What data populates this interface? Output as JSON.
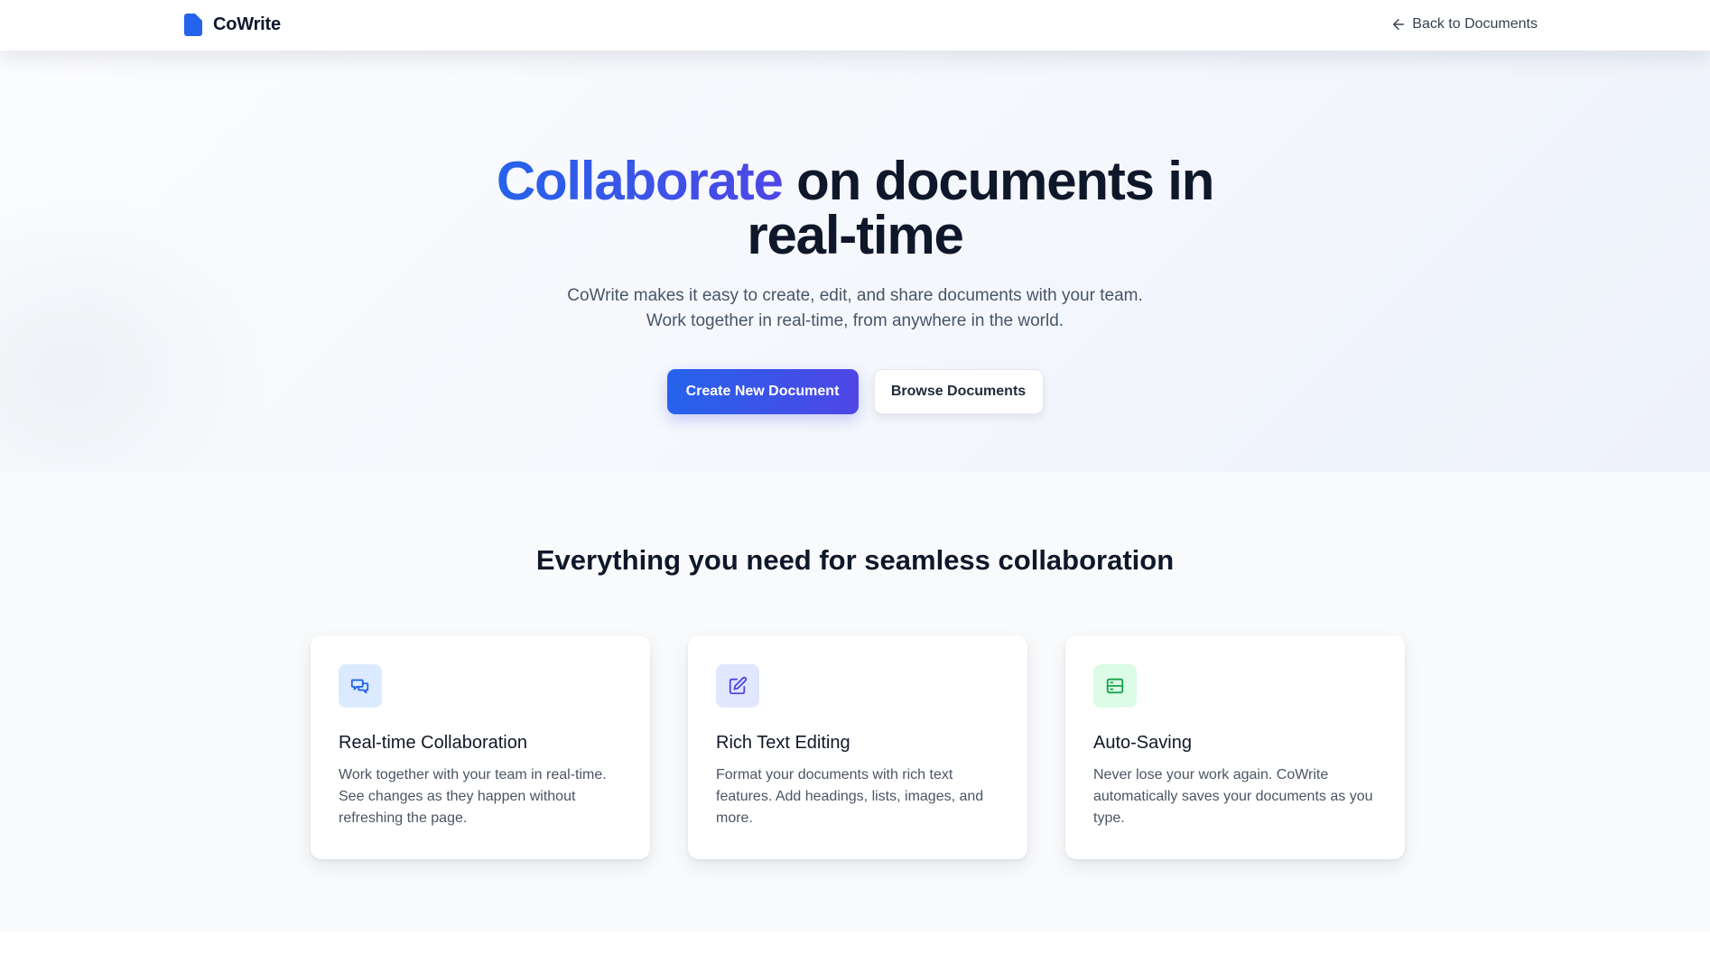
{
  "header": {
    "brand_name": "CoWrite",
    "back_label": "Back to Documents"
  },
  "hero": {
    "title_accent": "Collaborate",
    "title_rest_line1": " on documents in",
    "title_line2": "real-time",
    "subtitle_line1": "CoWrite makes it easy to create, edit, and share documents with your team.",
    "subtitle_line2": "Work together in real-time, from anywhere in the world.",
    "primary_button": "Create New Document",
    "secondary_button": "Browse Documents"
  },
  "features": {
    "heading": "Everything you need for seamless collaboration",
    "cards": [
      {
        "icon": "chat-bubbles-icon",
        "icon_color": "#2563eb",
        "icon_bg": "#dbeafe",
        "title": "Real-time Collaboration",
        "description": "Work together with your team in real-time. See changes as they happen without refreshing the page."
      },
      {
        "icon": "edit-icon",
        "icon_color": "#4f46e5",
        "icon_bg": "#e0e7ff",
        "title": "Rich Text Editing",
        "description": "Format your documents with rich text features. Add headings, lists, images, and more."
      },
      {
        "icon": "save-icon",
        "icon_color": "#16a34a",
        "icon_bg": "#dcfce7",
        "title": "Auto-Saving",
        "description": "Never lose your work again. CoWrite automatically saves your documents as you type."
      }
    ]
  },
  "colors": {
    "accent_start": "#2563eb",
    "accent_end": "#4f46e5",
    "text_dark": "#0f172a",
    "text_muted": "#475569"
  }
}
